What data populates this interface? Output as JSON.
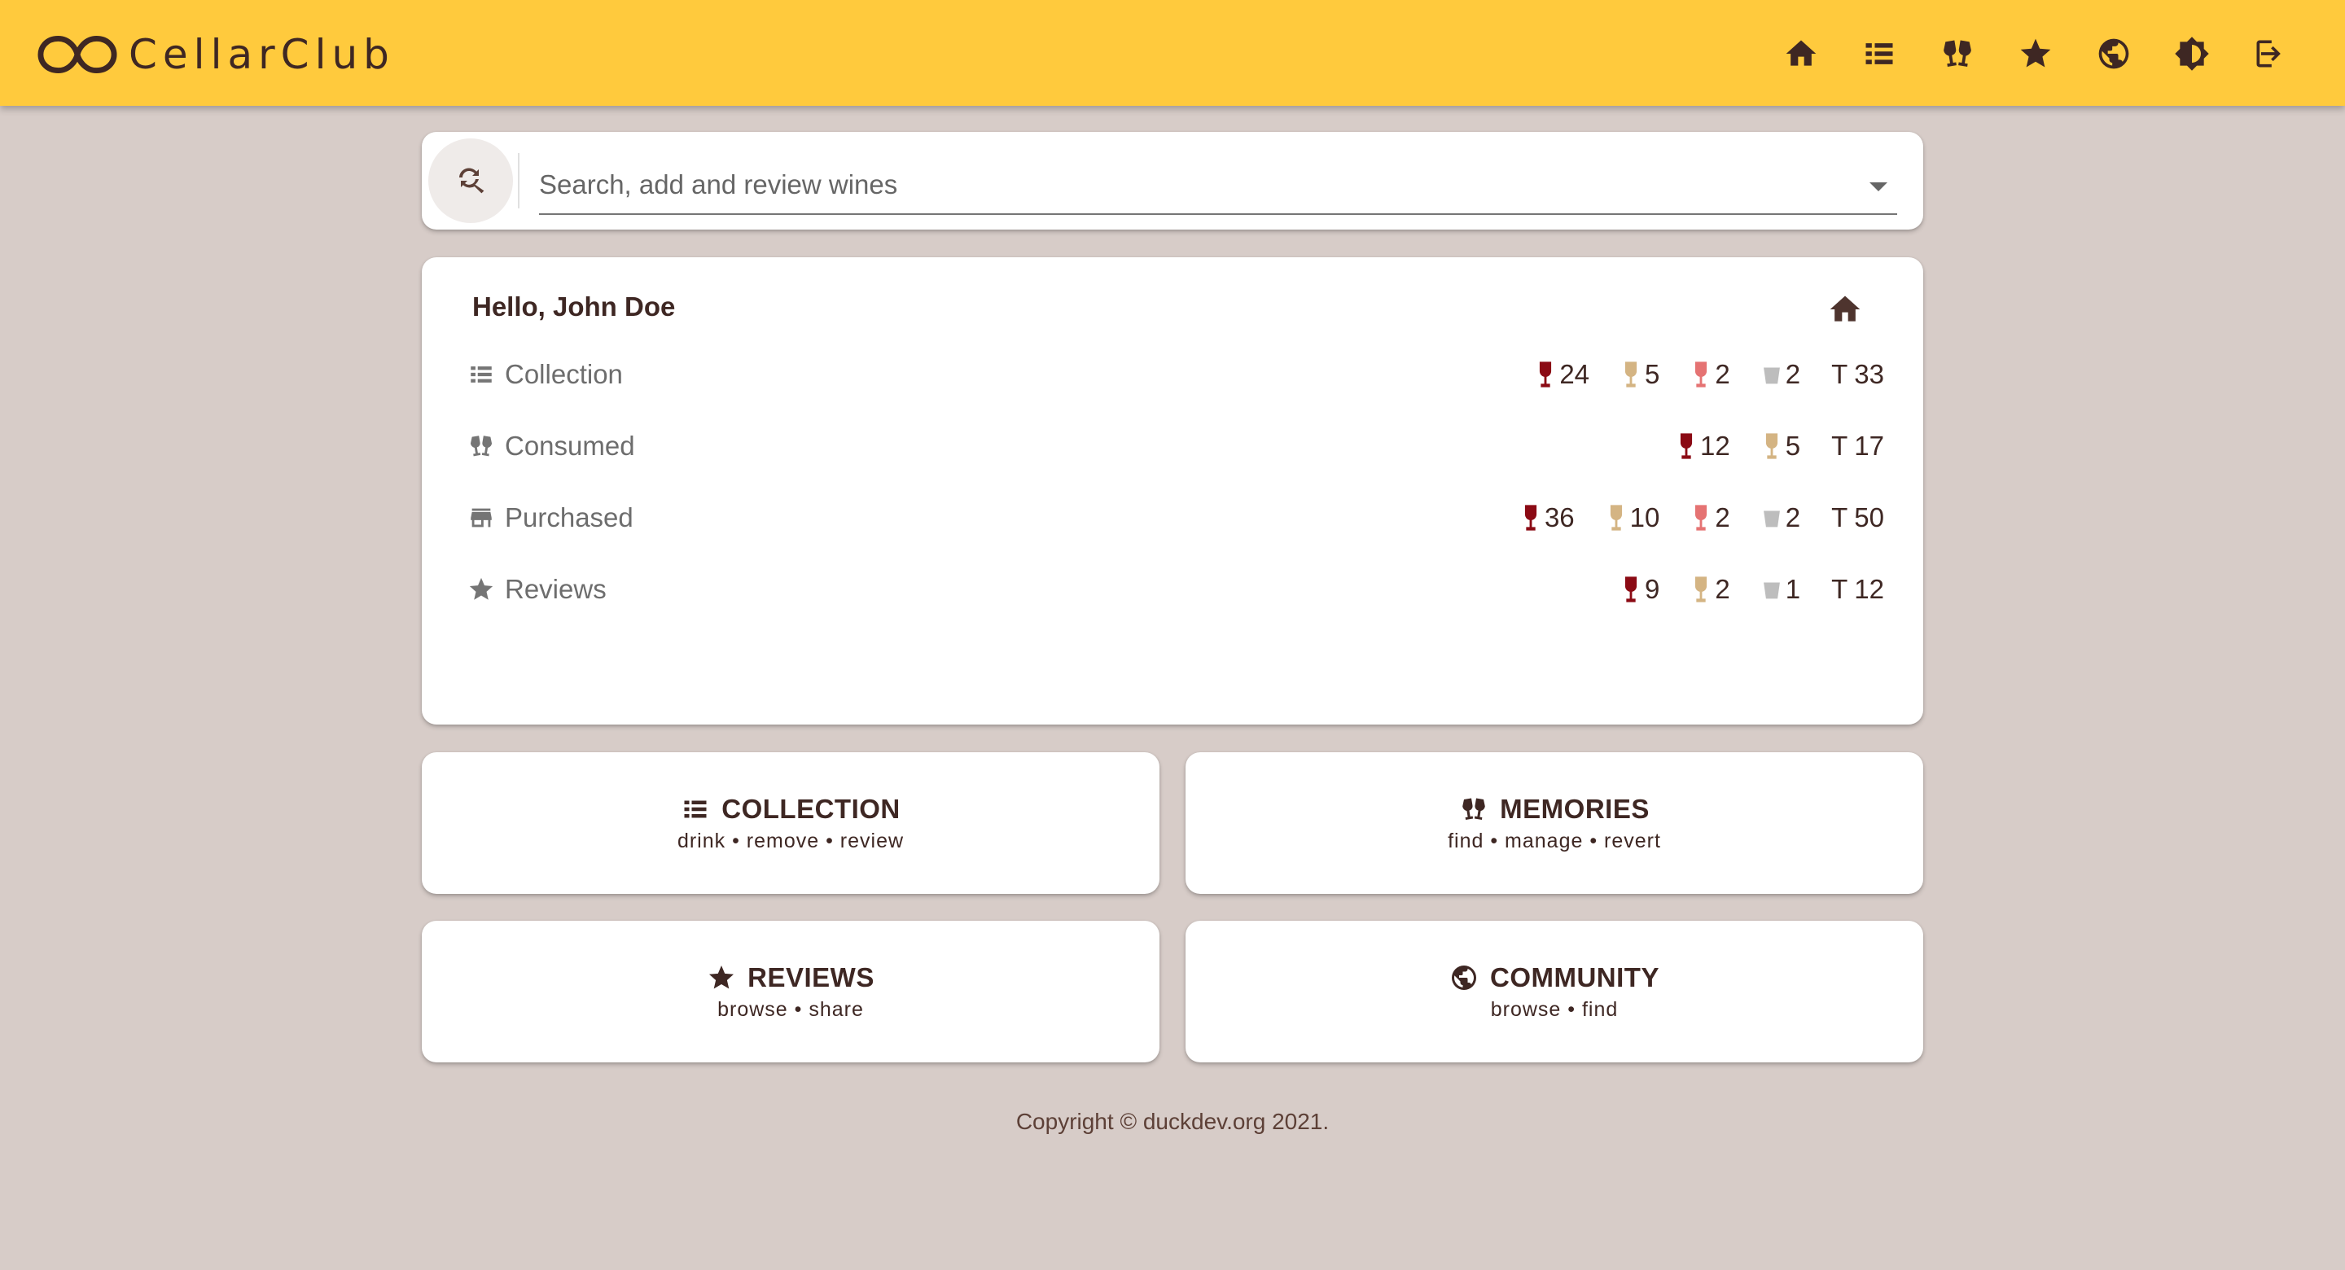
{
  "app": {
    "title": "CellarClub"
  },
  "nav": {
    "items": [
      {
        "name": "home-icon"
      },
      {
        "name": "collection-list-icon"
      },
      {
        "name": "cheers-icon"
      },
      {
        "name": "star-icon"
      },
      {
        "name": "globe-icon"
      },
      {
        "name": "brightness-icon"
      },
      {
        "name": "logout-icon"
      }
    ]
  },
  "search": {
    "placeholder": "Search, add and review wines",
    "value": ""
  },
  "summary": {
    "greeting": "Hello, John Doe",
    "rows": [
      {
        "label": "Collection",
        "icon": "list-icon",
        "red": "24",
        "white": "5",
        "rose": "2",
        "other": "2",
        "total_prefix": "T",
        "total": "33"
      },
      {
        "label": "Consumed",
        "icon": "cheers-icon",
        "red": "12",
        "white": "5",
        "total_prefix": "T",
        "total": "17"
      },
      {
        "label": "Purchased",
        "icon": "store-icon",
        "red": "36",
        "white": "10",
        "rose": "2",
        "other": "2",
        "total_prefix": "T",
        "total": "50"
      },
      {
        "label": "Reviews",
        "icon": "star-icon",
        "red": "9",
        "white": "2",
        "other": "1",
        "total_prefix": "T",
        "total": "12"
      }
    ]
  },
  "tiles": [
    {
      "title": "COLLECTION",
      "sub": "drink • remove • review",
      "icon": "list-icon"
    },
    {
      "title": "MEMORIES",
      "sub": "find • manage • revert",
      "icon": "cheers-icon"
    },
    {
      "title": "REVIEWS",
      "sub": "browse • share",
      "icon": "star-icon"
    },
    {
      "title": "COMMUNITY",
      "sub": "browse • find",
      "icon": "globe-icon"
    }
  ],
  "footer": {
    "text": "Copyright © duckdev.org 2021."
  },
  "colors": {
    "appbar": "#ffca3d",
    "background": "#d7ccc8",
    "red_wine": "#8b0a14",
    "white_wine": "#d4b483",
    "rose_wine": "#e57373",
    "other_wine": "#bdbdbd"
  }
}
